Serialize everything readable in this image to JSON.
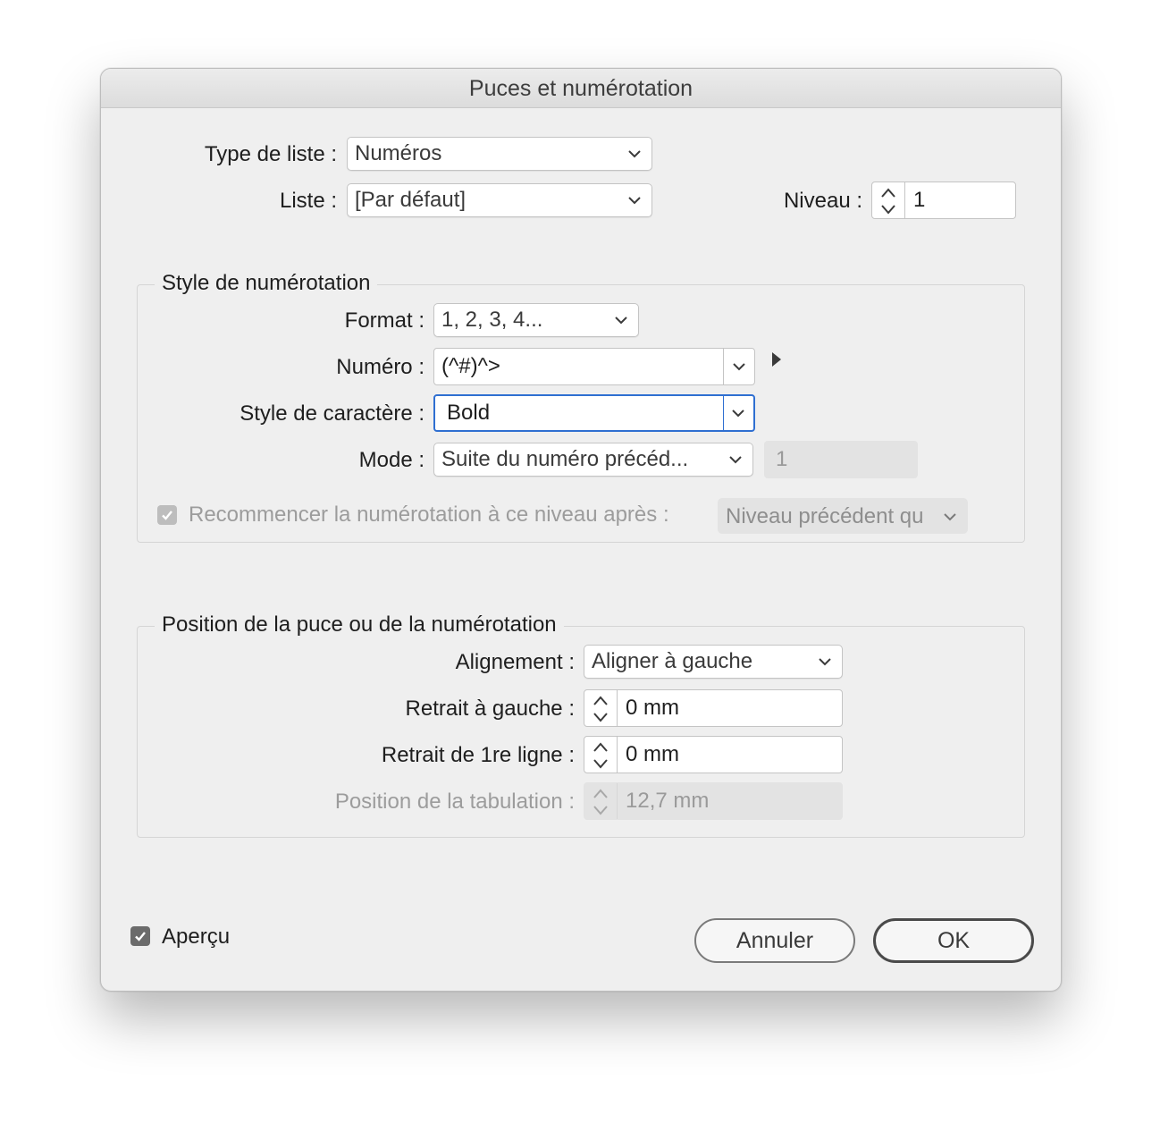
{
  "window": {
    "title": "Puces et numérotation"
  },
  "list": {
    "type_label": "Type de liste :",
    "type_value": "Numéros",
    "list_label": "Liste :",
    "list_value": "[Par défaut]",
    "level_label": "Niveau :",
    "level_value": "1"
  },
  "numbering_style": {
    "title": "Style de numérotation",
    "format_label": "Format :",
    "format_value": "1, 2, 3, 4...",
    "number_label": "Numéro :",
    "number_value": "(^#)^>",
    "char_style_label": "Style de caractère :",
    "char_style_value": "Bold",
    "mode_label": "Mode :",
    "mode_value": "Suite du numéro précéd...",
    "mode_start_value": "1",
    "restart_label": "Recommencer la numérotation à ce niveau après :",
    "restart_value": "Niveau précédent qu"
  },
  "position": {
    "title": "Position de la puce ou de la numérotation",
    "alignment_label": "Alignement :",
    "alignment_value": "Aligner à gauche",
    "left_indent_label": "Retrait à gauche :",
    "left_indent_value": "0 mm",
    "first_line_label": "Retrait de 1re ligne :",
    "first_line_value": "0 mm",
    "tab_position_label": "Position de la tabulation :",
    "tab_position_value": "12,7 mm"
  },
  "footer": {
    "preview_label": "Aperçu",
    "cancel_label": "Annuler",
    "ok_label": "OK"
  },
  "colors": {
    "focus_ring": "#2f6fd1",
    "dialog_bg": "#efefef"
  },
  "icons": [
    "chevron-down-icon",
    "stepper-icon",
    "triangle-right-icon",
    "checkmark-icon"
  ]
}
